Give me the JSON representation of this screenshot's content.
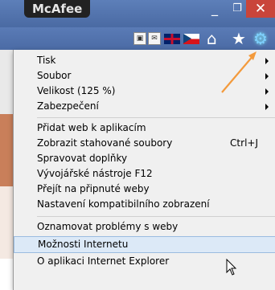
{
  "window": {
    "app_title": "McAfee",
    "minimize_glyph": "_",
    "maximize_glyph": "❐",
    "close_glyph": "✕"
  },
  "toolbar": {
    "icons": [
      "page-icon",
      "mail-icon",
      "uk-flag-icon",
      "czech-flag-icon",
      "home-icon",
      "favorites-star-icon",
      "tools-gear-icon"
    ]
  },
  "menu": {
    "items": [
      {
        "label": "Tisk",
        "submenu": true
      },
      {
        "label": "Soubor",
        "submenu": true
      },
      {
        "label": "Velikost (125 %)",
        "submenu": true
      },
      {
        "label": "Zabezpečení",
        "submenu": true
      },
      {
        "label": "Přidat web k aplikacím"
      },
      {
        "label": "Zobrazit stahované soubory",
        "shortcut": "Ctrl+J"
      },
      {
        "label": "Spravovat doplňky"
      },
      {
        "label": "Vývojářské nástroje F12"
      },
      {
        "label": "Přejít na připnuté weby"
      },
      {
        "label": "Nastavení kompatibilního zobrazení"
      },
      {
        "label": "Oznamovat problémy s weby"
      },
      {
        "label": "Možnosti Internetu",
        "highlighted": true
      },
      {
        "label": "O aplikaci Internet Explorer"
      }
    ]
  },
  "colors": {
    "accent_arrow": "#f39a3c",
    "highlight_bg": "#dce9f7",
    "close_button": "#c9453b"
  }
}
